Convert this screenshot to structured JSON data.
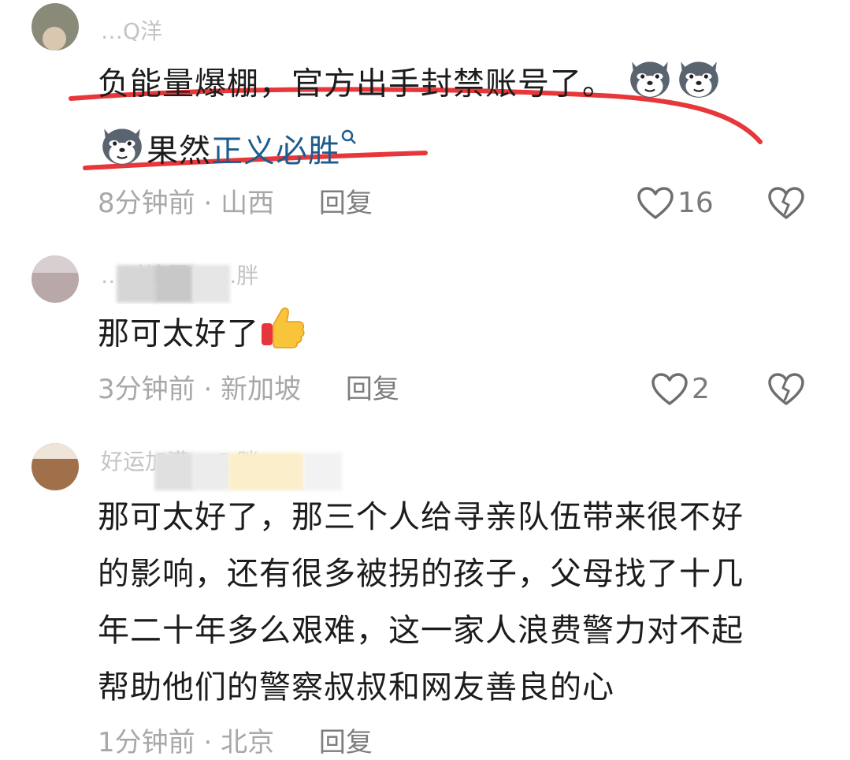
{
  "comments": [
    {
      "username": "…Q洋",
      "text": "负能量爆棚，官方出手封禁账号了。",
      "text_line2_prefix": "果然",
      "search_link": "正义必胜",
      "time": "8分钟前",
      "location": "山西",
      "reply_label": "回复",
      "likes": "16",
      "emoji_icon": "wolf-head-emoji"
    },
    {
      "username": "…时情愿 ▸ C.胖",
      "text": "那可太好了",
      "emoji_icon": "thumbs-up-emoji",
      "time": "3分钟前",
      "location": "新加坡",
      "reply_label": "回复",
      "likes": "2"
    },
    {
      "username": "好运加满 ▸ C.胖",
      "text_lines": [
        "那可太好了，那三个人给寻亲队伍带来很不好",
        "的影响，还有很多被拐的孩子，父母找了十几",
        "年二十年多么艰难，这一家人浪费警力对不起",
        "帮助他们的警察叔叔和网友善良的心"
      ],
      "time": "1分钟前",
      "location": "北京",
      "reply_label": "回复"
    }
  ],
  "colors": {
    "link": "#1d5c8c",
    "underline_marker": "#e8373a",
    "meta_gray": "#a8a8a8"
  }
}
